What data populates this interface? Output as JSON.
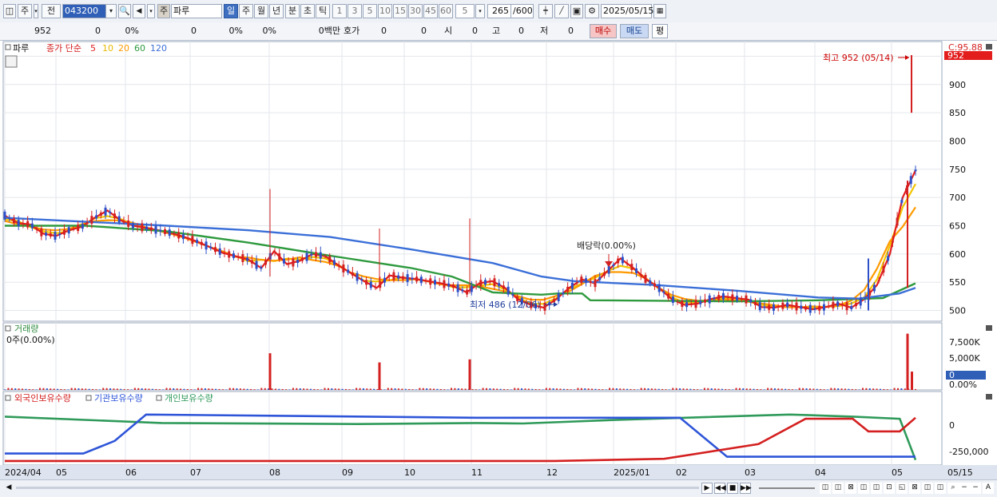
{
  "toolbar": {
    "period_prefix": "주",
    "prev_label": "전",
    "code": "043200",
    "type_badge": "주",
    "name": "파루",
    "period_tabs": [
      "일",
      "주",
      "월",
      "년",
      "분",
      "초",
      "틱"
    ],
    "minute_options": [
      "1",
      "3",
      "5",
      "10",
      "15",
      "30",
      "45",
      "60"
    ],
    "interval_value": "5",
    "count": "265",
    "count_total": "/600",
    "date": "2025/05/15"
  },
  "quote_bar": {
    "price": "952",
    "change": "0",
    "change_pct": "0%",
    "volume": "0",
    "vol_pct": "0%",
    "pct3": "0%",
    "amount": "0백만",
    "quote_label": "호가",
    "quote_val1": "0",
    "quote_val2": "0",
    "open_label": "시",
    "open_val": "0",
    "high_label": "고",
    "high_val": "0",
    "low_label": "저",
    "low_val": "0",
    "buy_label": "매수",
    "sell_label": "매도",
    "avg_label": "평"
  },
  "price_panel": {
    "legend_name": "파루",
    "legend_ma": "종가 단순",
    "ma_labels": [
      "5",
      "10",
      "20",
      "60",
      "120"
    ],
    "ma_colors": [
      "#e31c1c",
      "#f2c500",
      "#ff9a00",
      "#2e9a3e",
      "#3b6fd8"
    ],
    "top_right_label": "C:95.88",
    "current_tag": "952",
    "high_annotation": "최고 952 (05/14)",
    "low_annotation": "최저 486 (12/06)",
    "event_annotation": "배당락(0.00%)",
    "y_ticks": [
      "950",
      "900",
      "850",
      "800",
      "750",
      "700",
      "650",
      "600",
      "550",
      "500"
    ]
  },
  "volume_panel": {
    "title": "거래량",
    "sub": "0주(0.00%)",
    "y_ticks": [
      "7,500K",
      "5,000K",
      "2,500K",
      "0.00%"
    ],
    "current_tag": "0"
  },
  "holdings_panel": {
    "legend": [
      "외국인보유수량",
      "기관보유수량",
      "개인보유수량"
    ],
    "legend_colors": [
      "#d42020",
      "#2e55d8",
      "#2f9a5a"
    ],
    "y_ticks": [
      "0",
      "-250,000"
    ]
  },
  "x_axis": {
    "labels": [
      "2024/04",
      "05",
      "06",
      "07",
      "08",
      "09",
      "10",
      "11",
      "12",
      "2025/01",
      "02",
      "03",
      "04",
      "05"
    ],
    "end_label": "05/15"
  },
  "chart_data": {
    "type": "candlestick",
    "price_range": [
      460,
      975
    ],
    "months": [
      "2024/04",
      "05",
      "06",
      "07",
      "08",
      "09",
      "10",
      "11",
      "12",
      "2025/01",
      "02",
      "03",
      "04",
      "05"
    ],
    "close_series": [
      668,
      655,
      652,
      636,
      632,
      642,
      648,
      664,
      677,
      660,
      650,
      646,
      642,
      637,
      630,
      622,
      612,
      602,
      596,
      590,
      575,
      605,
      582,
      588,
      600,
      596,
      580,
      566,
      552,
      540,
      562,
      558,
      556,
      552,
      548,
      543,
      532,
      548,
      552,
      540,
      520,
      510,
      505,
      520,
      540,
      555,
      548,
      570,
      592,
      575,
      555,
      540,
      520,
      510,
      512,
      520,
      525,
      522,
      519,
      506,
      505,
      510,
      506,
      502,
      506,
      512,
      505,
      520,
      545,
      600,
      700,
      748
    ],
    "ma60_points": [
      [
        0,
        650
      ],
      [
        10,
        650
      ],
      [
        20,
        640
      ],
      [
        30,
        620
      ],
      [
        40,
        597
      ],
      [
        50,
        575
      ],
      [
        55,
        560
      ],
      [
        60,
        532
      ],
      [
        66,
        528
      ],
      [
        68,
        530
      ],
      [
        71,
        530
      ],
      [
        72,
        518
      ],
      [
        90,
        516
      ],
      [
        100,
        518
      ],
      [
        108,
        522
      ],
      [
        112,
        548
      ]
    ],
    "ma120_points": [
      [
        0,
        664
      ],
      [
        20,
        650
      ],
      [
        30,
        642
      ],
      [
        40,
        630
      ],
      [
        50,
        608
      ],
      [
        60,
        584
      ],
      [
        66,
        560
      ],
      [
        70,
        552
      ],
      [
        80,
        545
      ],
      [
        90,
        535
      ],
      [
        100,
        523
      ],
      [
        105,
        521
      ],
      [
        110,
        530
      ],
      [
        112,
        540
      ]
    ],
    "high_marker": {
      "label": "최고",
      "value": 952,
      "date": "05/14"
    },
    "low_marker": {
      "label": "최저",
      "value": 486,
      "date": "12/06"
    },
    "volume_spikes_k": [
      {
        "month": "08",
        "value": 6000
      },
      {
        "month": "09",
        "value": 4500
      },
      {
        "month": "11",
        "value": 5000
      },
      {
        "month": "05",
        "value": 9200
      }
    ],
    "holdings": {
      "foreign": [
        [
          0,
          -340000
        ],
        [
          70,
          -340000
        ],
        [
          84,
          -320000
        ],
        [
          96,
          -180000
        ],
        [
          102,
          60000
        ],
        [
          108,
          60000
        ],
        [
          110,
          -60000
        ],
        [
          114,
          -60000
        ],
        [
          116,
          70000
        ]
      ],
      "institution": [
        [
          0,
          -270000
        ],
        [
          10,
          -270000
        ],
        [
          14,
          -150000
        ],
        [
          18,
          100000
        ],
        [
          60,
          70000
        ],
        [
          86,
          70000
        ],
        [
          92,
          -300000
        ],
        [
          116,
          -300000
        ]
      ],
      "individual": [
        [
          0,
          80000
        ],
        [
          20,
          20000
        ],
        [
          45,
          10000
        ],
        [
          60,
          20000
        ],
        [
          66,
          15000
        ],
        [
          78,
          50000
        ],
        [
          100,
          100000
        ],
        [
          108,
          80000
        ],
        [
          114,
          60000
        ],
        [
          116,
          -330000
        ]
      ]
    }
  }
}
